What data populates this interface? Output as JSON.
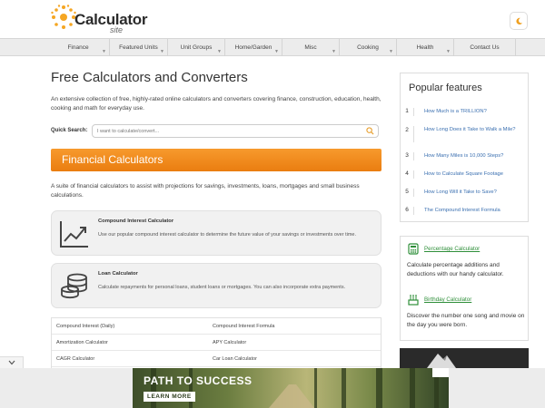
{
  "header": {
    "logo_text": "Calculator",
    "logo_sub": "site",
    "mode_icon": "moon-icon"
  },
  "nav": {
    "items": [
      "Finance",
      "Featured Units",
      "Unit Groups",
      "Home/Garden",
      "Misc",
      "Cooking",
      "Health",
      "Contact Us"
    ]
  },
  "main": {
    "title": "Free Calculators and Converters",
    "intro": "An extensive collection of free, highly-rated online calculators and converters covering finance, construction, education, health, cooking and math for everyday use.",
    "quick_search_label": "Quick Search:",
    "quick_search_placeholder": "I want to calculate/convert...",
    "section_title": "Financial Calculators",
    "section_desc": "A suite of financial calculators to assist with projections for savings, investments, loans, mortgages and small business calculations.",
    "cards": [
      {
        "title": "Compound Interest Calculator",
        "desc": "Use our popular compound interest calculator to determine the future value of your savings or investments over time.",
        "icon": "line-chart-icon"
      },
      {
        "title": "Loan Calculator",
        "desc": "Calculate repayments for personal loans, student loans or mortgages. You can also incorporate extra payments.",
        "icon": "coin-stack-icon"
      }
    ],
    "list": [
      [
        "Compound Interest (Daily)",
        "Compound Interest Formula"
      ],
      [
        "Amortization Calculator",
        "APY Calculator"
      ],
      [
        "CAGR Calculator",
        "Car Loan Calculator"
      ]
    ]
  },
  "sidebar": {
    "popular_title": "Popular features",
    "popular": [
      {
        "num": "1",
        "label": "How Much is a TRILLION?"
      },
      {
        "num": "2",
        "label": "How Long Does it Take to Walk a Mile?"
      },
      {
        "num": "3",
        "label": "How Many Miles is 10,000 Steps?"
      },
      {
        "num": "4",
        "label": "How to Calculate Square Footage"
      },
      {
        "num": "5",
        "label": "How Long Will it Take to Save?"
      },
      {
        "num": "6",
        "label": "The Compound Interest Formula"
      }
    ],
    "features": [
      {
        "link": "Percentage Calculator",
        "desc": "Calculate percentage additions and deductions with our handy calculator.",
        "icon": "calculator-icon"
      },
      {
        "link": "Birthday Calculator",
        "desc": "Discover the number one song and movie on the day you were born.",
        "icon": "birthday-cake-icon"
      }
    ]
  },
  "ad": {
    "title": "PATH TO SUCCESS",
    "button": "LEARN MORE"
  },
  "colors": {
    "accent_orange": "#f0891c",
    "link_blue": "#3a6fb0",
    "link_green": "#2f8f3a",
    "logo_sun": "#f5a623"
  }
}
